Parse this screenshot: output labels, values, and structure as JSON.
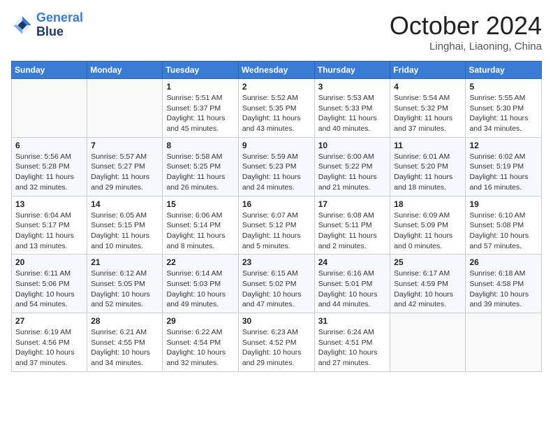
{
  "header": {
    "logo_line1": "General",
    "logo_line2": "Blue",
    "month": "October 2024",
    "location": "Linghai, Liaoning, China"
  },
  "weekdays": [
    "Sunday",
    "Monday",
    "Tuesday",
    "Wednesday",
    "Thursday",
    "Friday",
    "Saturday"
  ],
  "weeks": [
    [
      {
        "day": "",
        "info": ""
      },
      {
        "day": "",
        "info": ""
      },
      {
        "day": "1",
        "info": "Sunrise: 5:51 AM\nSunset: 5:37 PM\nDaylight: 11 hours and 45 minutes."
      },
      {
        "day": "2",
        "info": "Sunrise: 5:52 AM\nSunset: 5:35 PM\nDaylight: 11 hours and 43 minutes."
      },
      {
        "day": "3",
        "info": "Sunrise: 5:53 AM\nSunset: 5:33 PM\nDaylight: 11 hours and 40 minutes."
      },
      {
        "day": "4",
        "info": "Sunrise: 5:54 AM\nSunset: 5:32 PM\nDaylight: 11 hours and 37 minutes."
      },
      {
        "day": "5",
        "info": "Sunrise: 5:55 AM\nSunset: 5:30 PM\nDaylight: 11 hours and 34 minutes."
      }
    ],
    [
      {
        "day": "6",
        "info": "Sunrise: 5:56 AM\nSunset: 5:28 PM\nDaylight: 11 hours and 32 minutes."
      },
      {
        "day": "7",
        "info": "Sunrise: 5:57 AM\nSunset: 5:27 PM\nDaylight: 11 hours and 29 minutes."
      },
      {
        "day": "8",
        "info": "Sunrise: 5:58 AM\nSunset: 5:25 PM\nDaylight: 11 hours and 26 minutes."
      },
      {
        "day": "9",
        "info": "Sunrise: 5:59 AM\nSunset: 5:23 PM\nDaylight: 11 hours and 24 minutes."
      },
      {
        "day": "10",
        "info": "Sunrise: 6:00 AM\nSunset: 5:22 PM\nDaylight: 11 hours and 21 minutes."
      },
      {
        "day": "11",
        "info": "Sunrise: 6:01 AM\nSunset: 5:20 PM\nDaylight: 11 hours and 18 minutes."
      },
      {
        "day": "12",
        "info": "Sunrise: 6:02 AM\nSunset: 5:19 PM\nDaylight: 11 hours and 16 minutes."
      }
    ],
    [
      {
        "day": "13",
        "info": "Sunrise: 6:04 AM\nSunset: 5:17 PM\nDaylight: 11 hours and 13 minutes."
      },
      {
        "day": "14",
        "info": "Sunrise: 6:05 AM\nSunset: 5:15 PM\nDaylight: 11 hours and 10 minutes."
      },
      {
        "day": "15",
        "info": "Sunrise: 6:06 AM\nSunset: 5:14 PM\nDaylight: 11 hours and 8 minutes."
      },
      {
        "day": "16",
        "info": "Sunrise: 6:07 AM\nSunset: 5:12 PM\nDaylight: 11 hours and 5 minutes."
      },
      {
        "day": "17",
        "info": "Sunrise: 6:08 AM\nSunset: 5:11 PM\nDaylight: 11 hours and 2 minutes."
      },
      {
        "day": "18",
        "info": "Sunrise: 6:09 AM\nSunset: 5:09 PM\nDaylight: 11 hours and 0 minutes."
      },
      {
        "day": "19",
        "info": "Sunrise: 6:10 AM\nSunset: 5:08 PM\nDaylight: 10 hours and 57 minutes."
      }
    ],
    [
      {
        "day": "20",
        "info": "Sunrise: 6:11 AM\nSunset: 5:06 PM\nDaylight: 10 hours and 54 minutes."
      },
      {
        "day": "21",
        "info": "Sunrise: 6:12 AM\nSunset: 5:05 PM\nDaylight: 10 hours and 52 minutes."
      },
      {
        "day": "22",
        "info": "Sunrise: 6:14 AM\nSunset: 5:03 PM\nDaylight: 10 hours and 49 minutes."
      },
      {
        "day": "23",
        "info": "Sunrise: 6:15 AM\nSunset: 5:02 PM\nDaylight: 10 hours and 47 minutes."
      },
      {
        "day": "24",
        "info": "Sunrise: 6:16 AM\nSunset: 5:01 PM\nDaylight: 10 hours and 44 minutes."
      },
      {
        "day": "25",
        "info": "Sunrise: 6:17 AM\nSunset: 4:59 PM\nDaylight: 10 hours and 42 minutes."
      },
      {
        "day": "26",
        "info": "Sunrise: 6:18 AM\nSunset: 4:58 PM\nDaylight: 10 hours and 39 minutes."
      }
    ],
    [
      {
        "day": "27",
        "info": "Sunrise: 6:19 AM\nSunset: 4:56 PM\nDaylight: 10 hours and 37 minutes."
      },
      {
        "day": "28",
        "info": "Sunrise: 6:21 AM\nSunset: 4:55 PM\nDaylight: 10 hours and 34 minutes."
      },
      {
        "day": "29",
        "info": "Sunrise: 6:22 AM\nSunset: 4:54 PM\nDaylight: 10 hours and 32 minutes."
      },
      {
        "day": "30",
        "info": "Sunrise: 6:23 AM\nSunset: 4:52 PM\nDaylight: 10 hours and 29 minutes."
      },
      {
        "day": "31",
        "info": "Sunrise: 6:24 AM\nSunset: 4:51 PM\nDaylight: 10 hours and 27 minutes."
      },
      {
        "day": "",
        "info": ""
      },
      {
        "day": "",
        "info": ""
      }
    ]
  ]
}
